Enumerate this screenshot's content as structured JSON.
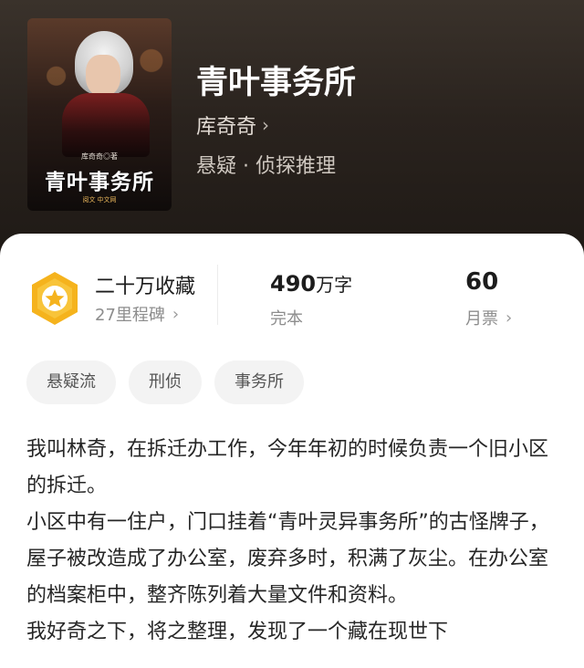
{
  "book": {
    "title": "青叶事务所",
    "author": "库奇奇",
    "genre": "悬疑 · 侦探推理",
    "cover": {
      "title": "青叶事务所",
      "author_line": "库奇奇◎著",
      "publisher_line": "阅文 中文网"
    }
  },
  "stats": {
    "collection_title": "二十万收藏",
    "collection_sub": "27里程碑",
    "words_value": "490",
    "words_unit": "万字",
    "status": "完本",
    "tickets_value": "60",
    "tickets_label": "月票"
  },
  "tags": [
    "悬疑流",
    "刑侦",
    "事务所"
  ],
  "description": {
    "p1": "我叫林奇，在拆迁办工作，今年年初的时候负责一个旧小区的拆迁。",
    "p2": "小区中有一住户，门口挂着“青叶灵异事务所”的古怪牌子，屋子被改造成了办公室，废弃多时，积满了灰尘。在办公室的档案柜中，整齐陈列着大量文件和资料。",
    "p3": "我好奇之下，将之整理，发现了一个藏在现世下"
  },
  "colors": {
    "badge_gold": "#F5B31D",
    "hero_bg": "#2A231E",
    "text_primary": "#1C1C1C",
    "text_secondary": "#8D8D8D"
  },
  "icons": [
    "badge-star-icon",
    "chevron-right-icon"
  ]
}
